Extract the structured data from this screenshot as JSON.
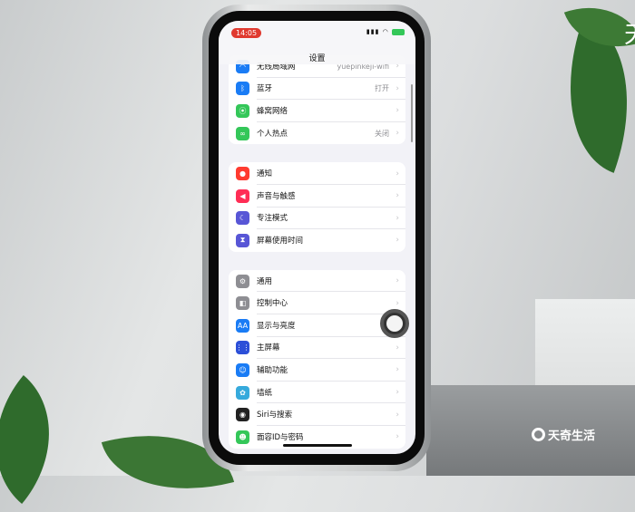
{
  "status": {
    "time": "14:05",
    "icons": [
      "signal-icon",
      "wifi-icon",
      "battery-charging-icon"
    ]
  },
  "nav": {
    "title": "设置"
  },
  "groups": [
    [
      {
        "label": "无线局域网",
        "value": "yuepinkeji-wifi",
        "icon": "wifi-icon",
        "color": "#1a7cf5"
      },
      {
        "label": "蓝牙",
        "value": "打开",
        "icon": "bluetooth-icon",
        "color": "#1a7cf5"
      },
      {
        "label": "蜂窝网络",
        "value": "",
        "icon": "antenna-icon",
        "color": "#34c759"
      },
      {
        "label": "个人热点",
        "value": "关闭",
        "icon": "hotspot-icon",
        "color": "#34c759"
      }
    ],
    [
      {
        "label": "通知",
        "icon": "bell-icon",
        "color": "#ff3b30"
      },
      {
        "label": "声音与触感",
        "icon": "speaker-icon",
        "color": "#ff2d55"
      },
      {
        "label": "专注模式",
        "icon": "moon-icon",
        "color": "#5856d6"
      },
      {
        "label": "屏幕使用时间",
        "icon": "hourglass-icon",
        "color": "#5856d6"
      }
    ],
    [
      {
        "label": "通用",
        "icon": "gear-icon",
        "color": "#8e8e93"
      },
      {
        "label": "控制中心",
        "icon": "toggles-icon",
        "color": "#8e8e93"
      },
      {
        "label": "显示与亮度",
        "icon": "text-size-icon",
        "color": "#1a7cf5"
      },
      {
        "label": "主屏幕",
        "icon": "grid-icon",
        "color": "#2c4fd8"
      },
      {
        "label": "辅助功能",
        "icon": "accessibility-icon",
        "color": "#1a7cf5"
      },
      {
        "label": "墙纸",
        "icon": "flower-icon",
        "color": "#36aadc"
      },
      {
        "label": "Siri与搜索",
        "icon": "siri-icon",
        "color": "#222"
      },
      {
        "label": "面容ID与密码",
        "icon": "face-id-icon",
        "color": "#34c759"
      }
    ]
  ],
  "watermark": "天奇生活",
  "corner_text": "天"
}
